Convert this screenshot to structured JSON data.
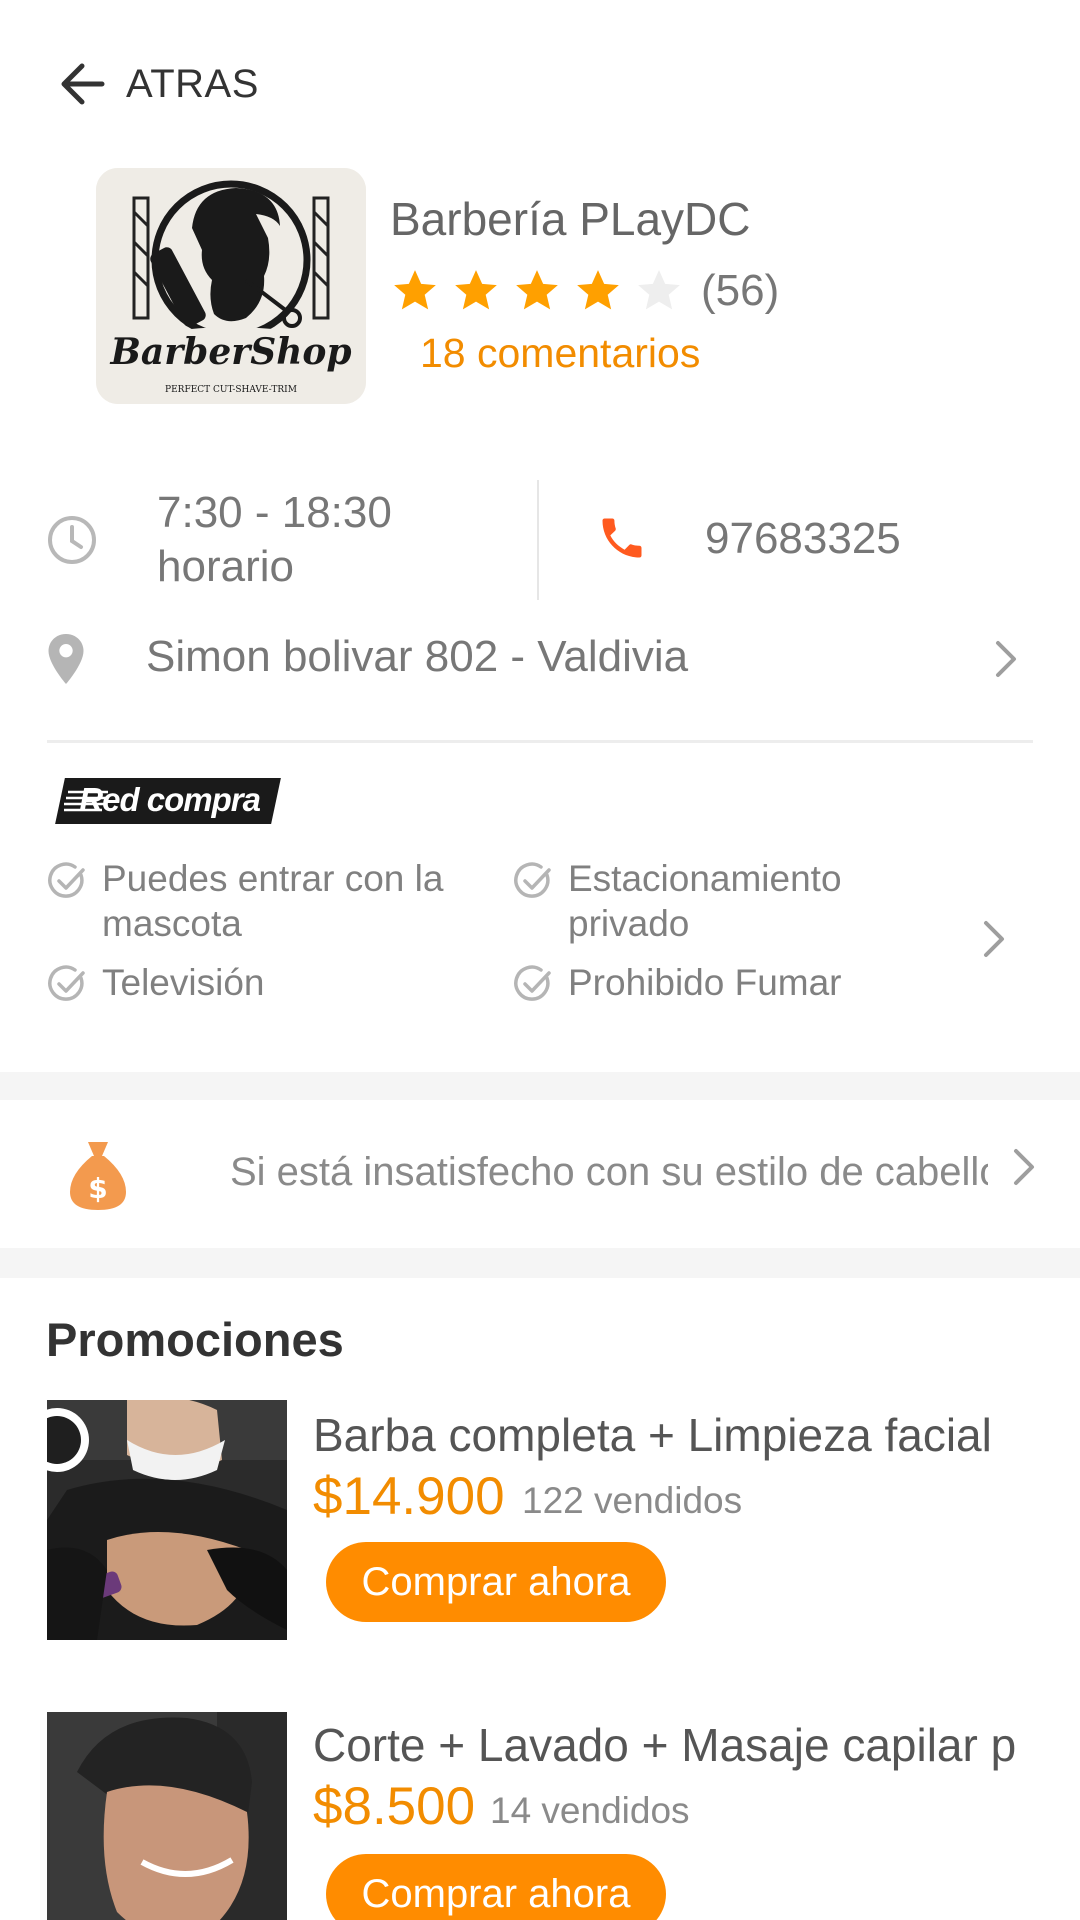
{
  "header": {
    "back_label": "ATRAS"
  },
  "shop": {
    "name": "Barbería PLayDC",
    "rating_value": 4,
    "rating_max": 5,
    "rating_count": "(56)",
    "comments_link": "18 comentarios",
    "logo": {
      "main_text": "BarberShop",
      "tagline": "PERFECT CUT-SHAVE-TRIM"
    }
  },
  "info": {
    "hours_time": "7:30 - 18:30",
    "hours_label": "horario",
    "phone": "97683325",
    "address": "Simon bolivar 802 - Valdivia"
  },
  "amenities": {
    "payment_badge": "Red compra",
    "items": [
      {
        "label_line1": "Puedes entrar con la",
        "label_line2": "mascota"
      },
      {
        "label_line1": "Estacionamiento",
        "label_line2": "privado"
      },
      {
        "label_line1": "Televisión",
        "label_line2": ""
      },
      {
        "label_line1": "Prohibido Fumar",
        "label_line2": ""
      }
    ]
  },
  "guarantee": {
    "text": "Si está insatisfecho con su estilo de cabello"
  },
  "promotions": {
    "title": "Promociones",
    "items": [
      {
        "name": "Barba completa + Limpieza facial",
        "price": "$14.900",
        "sold": "122 vendidos",
        "button": "Comprar ahora"
      },
      {
        "name": "Corte + Lavado + Masaje capilar p",
        "price": "$8.500",
        "sold": "14 vendidos",
        "button": "Comprar ahora"
      }
    ]
  },
  "colors": {
    "accent": "#f28c00",
    "button": "#ff8c00",
    "phone": "#ff5a1f",
    "star_filled": "#ffa000",
    "star_empty": "#eeeeee"
  }
}
